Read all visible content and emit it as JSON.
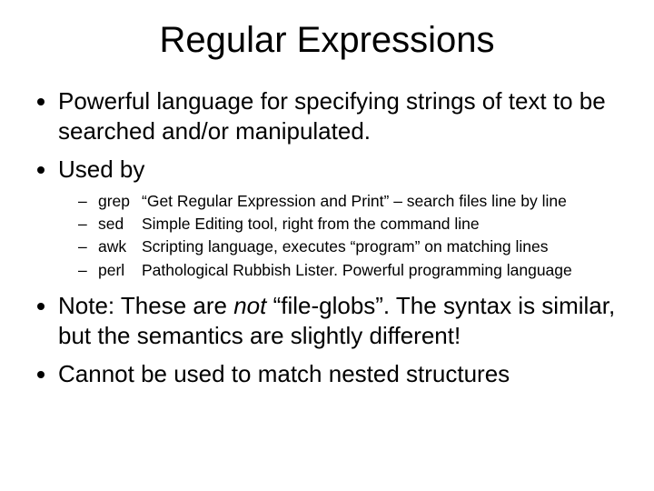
{
  "title": "Regular Expressions",
  "b1": "Powerful language for specifying strings of text to be searched and/or manipulated.",
  "b2": "Used by",
  "tools": {
    "t0": {
      "name": "grep",
      "desc": "“Get Regular Expression and Print” – search files line by line"
    },
    "t1": {
      "name": "sed",
      "desc": "Simple Editing tool, right from the command line"
    },
    "t2": {
      "name": "awk",
      "desc": "Scripting language, executes “program” on matching lines"
    },
    "t3": {
      "name": "perl",
      "desc": "Pathological Rubbish Lister. Powerful programming language"
    }
  },
  "b3a": "Note: These are ",
  "b3b": "not",
  "b3c": " “file-globs”. The syntax is similar, but the semantics are slightly different!",
  "b4": "Cannot be used to match nested structures"
}
